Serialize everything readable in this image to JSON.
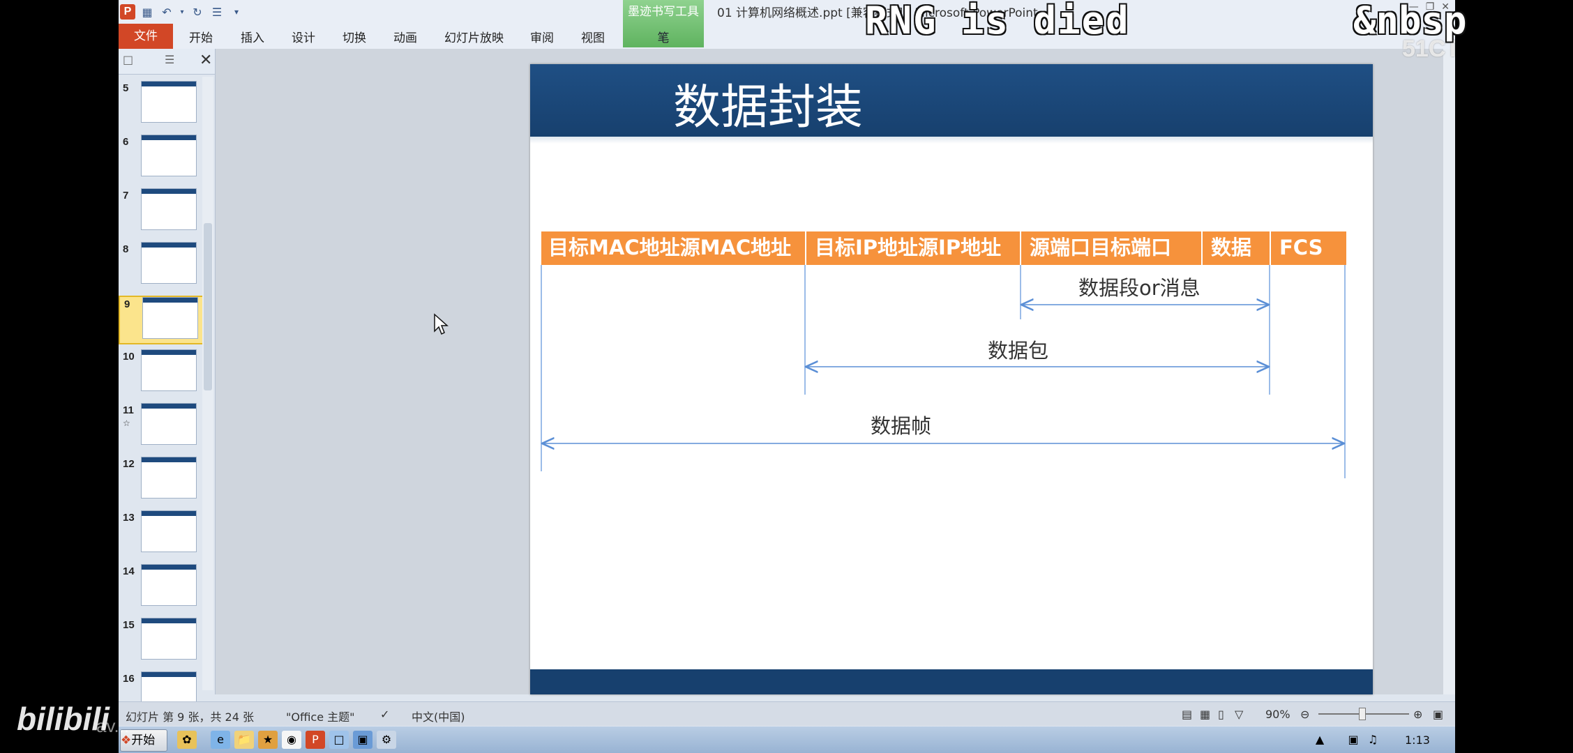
{
  "window": {
    "title": "01 计算机网络概述.ppt [兼容模式] - Microsoft PowerPoint",
    "context_tab_group": "墨迹书写工具",
    "context_tab": "笔"
  },
  "ribbon_tabs": [
    "文件",
    "开始",
    "插入",
    "设计",
    "切换",
    "动画",
    "幻灯片放映",
    "审阅",
    "视图"
  ],
  "overlays": {
    "rng": "RNG is died",
    "nbsp": "&nbsp",
    "watermark": "51CTO学院",
    "bilibili": "bilibili",
    "bilibili_sub": "av..."
  },
  "slide_panel": {
    "thumbnails": [
      {
        "num": "5"
      },
      {
        "num": "6"
      },
      {
        "num": "7"
      },
      {
        "num": "8"
      },
      {
        "num": "9",
        "selected": true
      },
      {
        "num": "10"
      },
      {
        "num": "11",
        "star": "☆"
      },
      {
        "num": "12"
      },
      {
        "num": "13"
      },
      {
        "num": "14"
      },
      {
        "num": "15"
      },
      {
        "num": "16"
      }
    ]
  },
  "slide": {
    "title": "数据封装",
    "header_cells": [
      "目标MAC地址源MAC地址",
      "目标IP地址源IP地址",
      "源端口目标端口",
      "数据",
      "FCS"
    ],
    "spans": {
      "segment": "数据段or消息",
      "packet": "数据包",
      "frame": "数据帧"
    }
  },
  "status_bar": {
    "slide_info": "幻灯片 第 9 张，共 24 张",
    "theme": "\"Office 主题\"",
    "language": "中文(中国)",
    "zoom": "90%"
  },
  "taskbar": {
    "start": "开始",
    "clock": "1:13"
  },
  "colors": {
    "slide_header": "#17406e",
    "table_header": "#f6923c",
    "file_tab": "#d24726",
    "dim_lines": "#5b8fd6"
  }
}
